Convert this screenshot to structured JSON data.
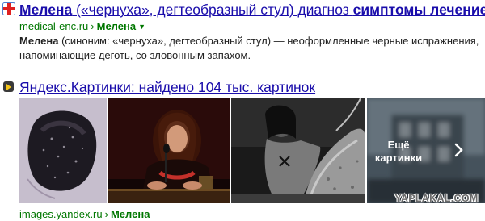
{
  "result1": {
    "title_bold": "Мелена",
    "title_mid": " («чернуха», дегтеобразный стул) диагноз ",
    "title_bold2": "симптомы лечение",
    "url_domain": "medical-enc.ru",
    "url_separator": "›",
    "url_crumb": "Мелена",
    "snippet_bold": "Мелена",
    "snippet_rest": " (синоним: «чернуха», дегтеобразный стул) — неоформленные черные испражнения, напоминающие деготь, со зловонным запахом.",
    "icon": "red-cross-icon"
  },
  "result2": {
    "title": "Яндекс.Картинки: найдено 104 тыс. картинок",
    "icon": "play-icon",
    "more_label_line1": "Ещё",
    "more_label_line2": "картинки",
    "url_domain": "images.yandex.ru",
    "url_separator": "›",
    "url_crumb": "Мелена",
    "watermark": "YAPLAKAL.COM"
  },
  "colors": {
    "link": "#1a0dab",
    "url_green": "#007700",
    "icon_red": "#e02020",
    "icon_yellow": "#f5c518"
  }
}
